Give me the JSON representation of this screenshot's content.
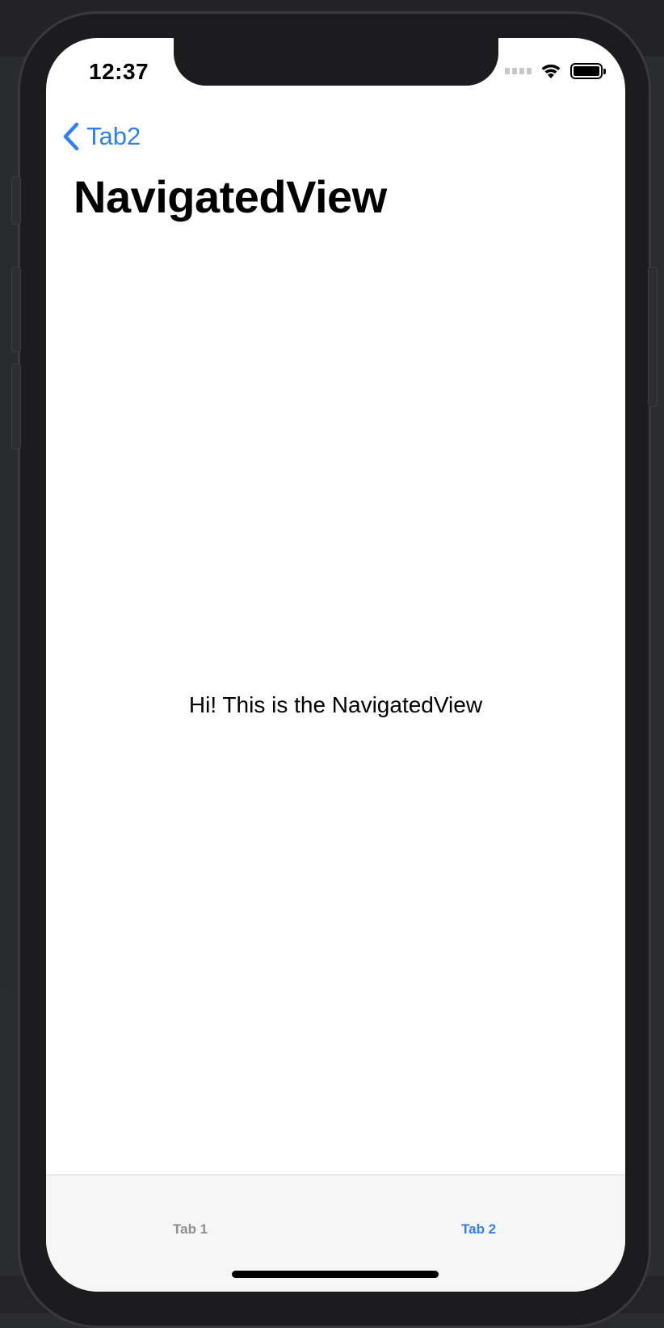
{
  "status_bar": {
    "time": "12:37"
  },
  "nav_bar": {
    "back_label": "Tab2",
    "title": "NavigatedView"
  },
  "content": {
    "message": "Hi! This is the NavigatedView"
  },
  "tab_bar": {
    "tabs": [
      {
        "label": "Tab 1",
        "selected": false
      },
      {
        "label": "Tab 2",
        "selected": true
      }
    ]
  },
  "colors": {
    "accent": "#2f7ff1",
    "inactive_tab": "#8e8e93",
    "tabbar_bg": "#f6f6f6",
    "device_frame": "#1c1c1e"
  },
  "icons": {
    "back": "chevron-left-icon",
    "wifi": "wifi-icon",
    "battery": "battery-icon",
    "signal": "cellular-signal-icon"
  }
}
